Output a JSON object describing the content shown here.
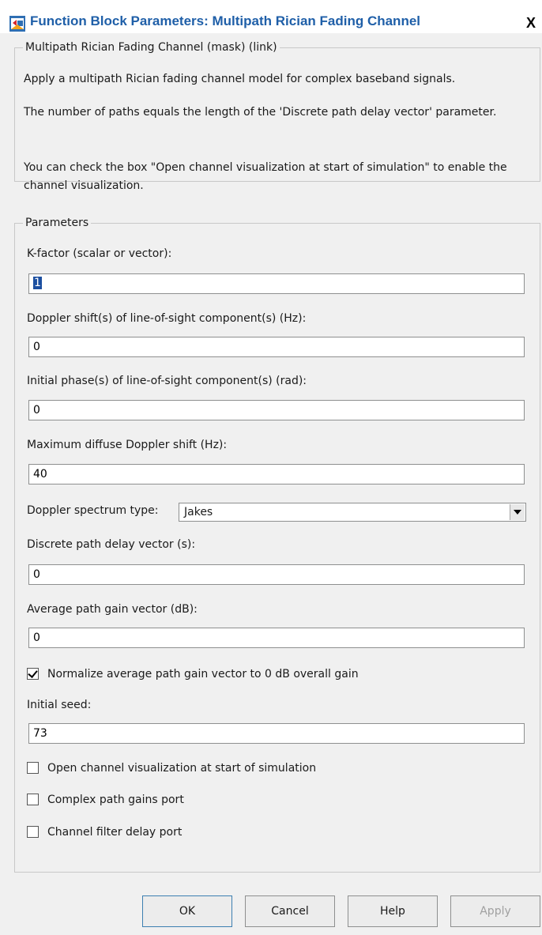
{
  "window": {
    "title": "Function Block Parameters: Multipath Rician Fading Channel",
    "close_label": "X"
  },
  "description": {
    "legend": "Multipath Rician Fading Channel (mask) (link)",
    "para1": "Apply a multipath Rician fading channel model for complex baseband signals.",
    "para2": "The number of paths equals the length of the 'Discrete path delay vector' parameter.",
    "para3": "You can check the box \"Open channel visualization at start of simulation\" to enable the channel visualization."
  },
  "parameters": {
    "legend": "Parameters",
    "k_factor": {
      "label": "K-factor (scalar or vector):",
      "value": "1"
    },
    "doppler_los": {
      "label": "Doppler shift(s) of line-of-sight component(s) (Hz):",
      "value": "0"
    },
    "initial_phase": {
      "label": "Initial phase(s) of line-of-sight component(s) (rad):",
      "value": "0"
    },
    "max_doppler": {
      "label": "Maximum diffuse Doppler shift (Hz):",
      "value": "40"
    },
    "doppler_spectrum": {
      "label": "Doppler spectrum type:",
      "value": "Jakes"
    },
    "path_delay": {
      "label": "Discrete path delay vector (s):",
      "value": "0"
    },
    "path_gain": {
      "label": "Average path gain vector (dB):",
      "value": "0"
    },
    "normalize": {
      "label": "Normalize average path gain vector to 0 dB overall gain",
      "checked": true
    },
    "initial_seed": {
      "label": "Initial seed:",
      "value": "73"
    },
    "open_viz": {
      "label": "Open channel visualization at start of simulation",
      "checked": false
    },
    "complex_gains_port": {
      "label": "Complex path gains port",
      "checked": false
    },
    "filter_delay_port": {
      "label": "Channel filter delay port",
      "checked": false
    }
  },
  "buttons": {
    "ok": "OK",
    "cancel": "Cancel",
    "help": "Help",
    "apply": "Apply"
  },
  "colors": {
    "title_text": "#1f5fa8",
    "selection": "#1c4fa0",
    "window_bg": "#f0f0f0"
  }
}
